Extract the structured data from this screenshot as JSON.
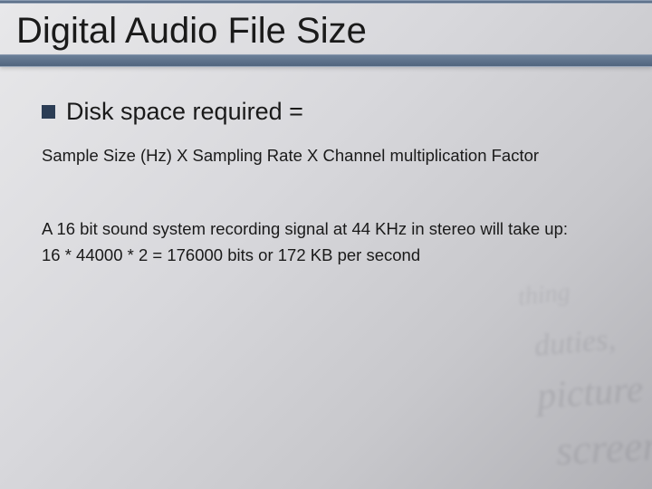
{
  "slide": {
    "title": "Digital Audio File Size",
    "bullet": {
      "label": "Disk space required ="
    },
    "formula": "Sample Size (Hz) X Sampling Rate X Channel multiplication Factor",
    "example": {
      "line1": "A 16 bit sound system recording signal at 44 KHz in stereo will take up:",
      "line2": "16 * 44000 * 2 = 176000 bits or 172 KB per second"
    },
    "bg_words": [
      "thing",
      "duties,",
      "picture",
      "screen"
    ]
  }
}
